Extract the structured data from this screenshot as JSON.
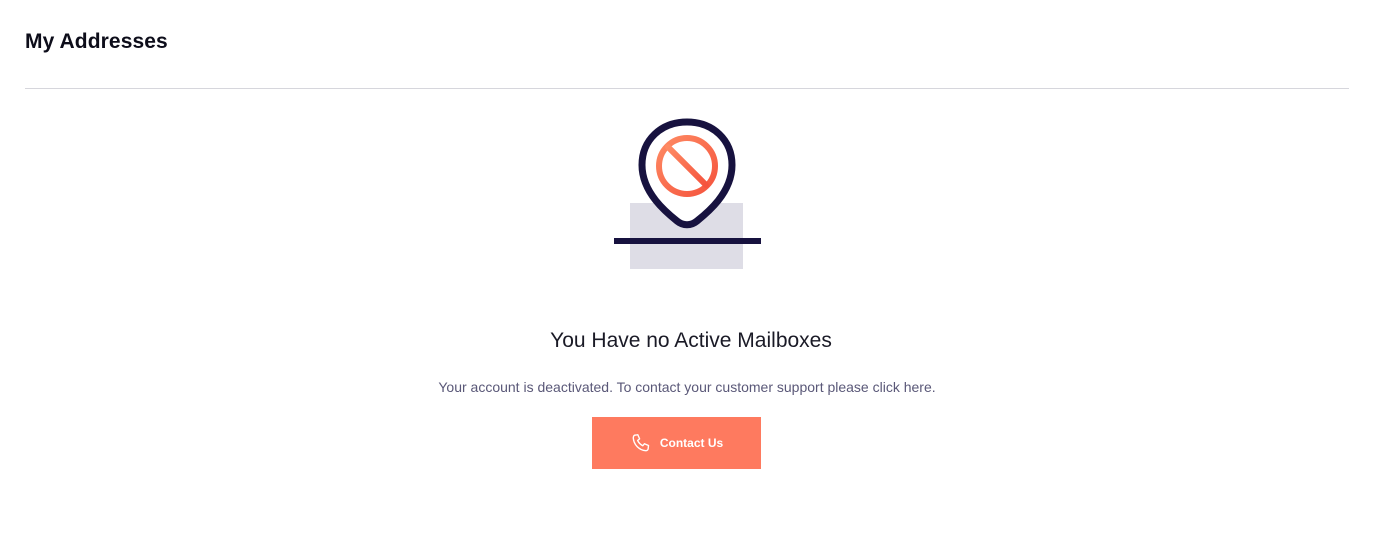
{
  "header": {
    "title": "My Addresses"
  },
  "empty_state": {
    "illustration_icon": "location-pin-blocked-icon",
    "title": "You Have no Active Mailboxes",
    "message": "Your account is deactivated. To contact your customer support please click here.",
    "button": {
      "label": "Contact Us",
      "icon": "phone-icon"
    }
  },
  "colors": {
    "accent": "#fe7a5f",
    "pin_stroke": "#17123f",
    "block_gradient_start": "#fe7a5f",
    "block_gradient_end": "#f5533d",
    "placeholder_box": "#dedde6",
    "message_text": "#5a5878"
  }
}
